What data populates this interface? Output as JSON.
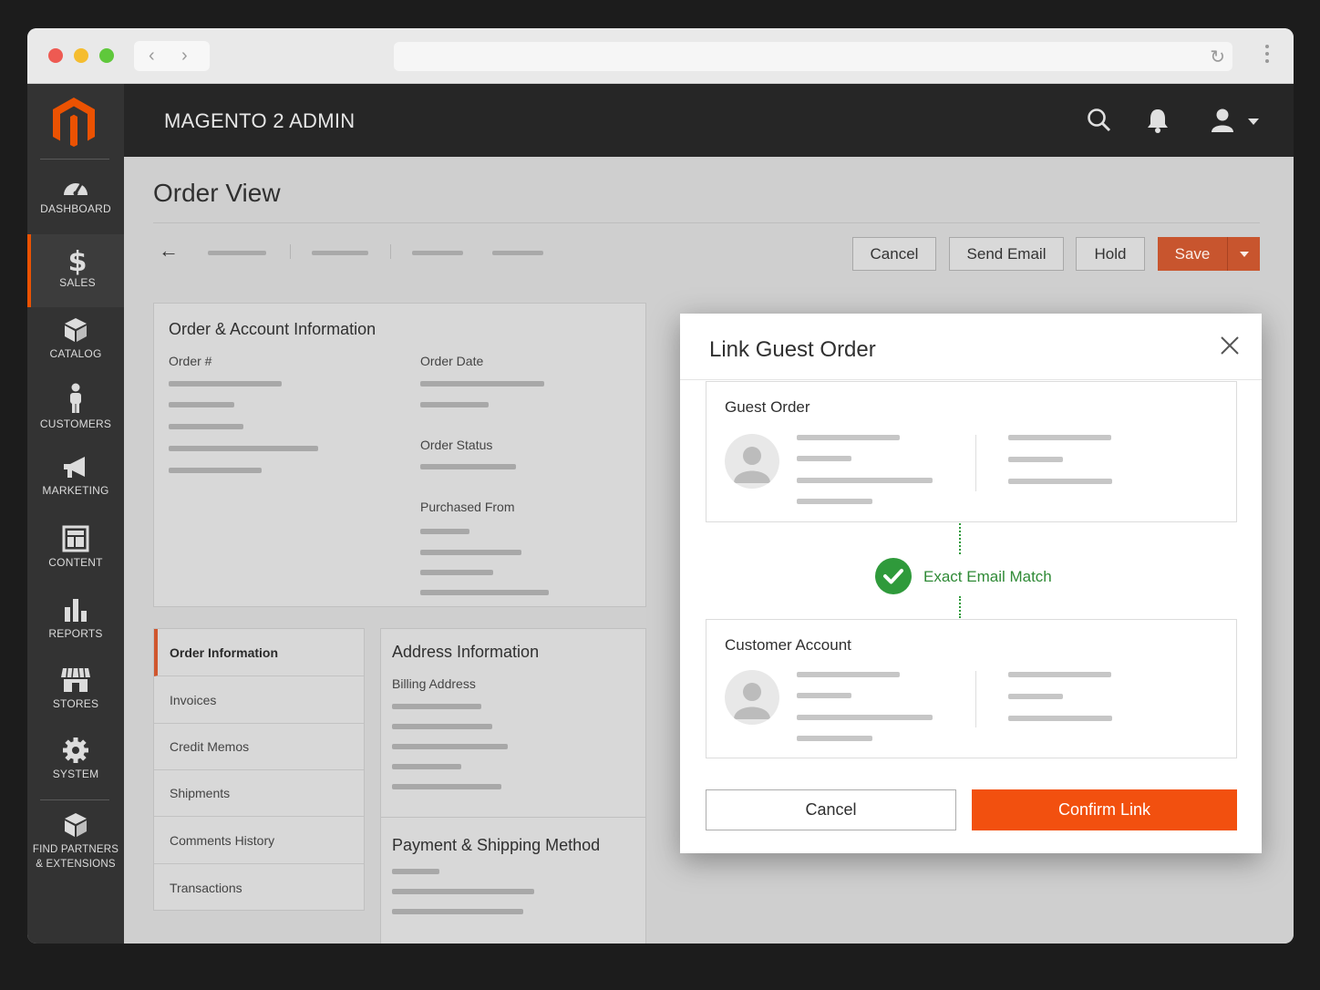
{
  "app": {
    "title": "MAGENTO 2 ADMIN"
  },
  "sidebar": {
    "items": [
      {
        "label": "DASHBOARD",
        "icon": "dashboard-icon"
      },
      {
        "label": "SALES",
        "icon": "dollar-icon",
        "active": true
      },
      {
        "label": "CATALOG",
        "icon": "box-icon"
      },
      {
        "label": "CUSTOMERS",
        "icon": "person-icon"
      },
      {
        "label": "MARKETING",
        "icon": "megaphone-icon"
      },
      {
        "label": "CONTENT",
        "icon": "layout-icon"
      },
      {
        "label": "REPORTS",
        "icon": "bar-chart-icon"
      },
      {
        "label": "STORES",
        "icon": "storefront-icon"
      },
      {
        "label": "SYSTEM",
        "icon": "gear-icon"
      }
    ],
    "partners": {
      "line1": "FIND PARTNERS",
      "line2": "& EXTENSIONS",
      "icon": "cube-icon"
    }
  },
  "header_icons": [
    "search-icon",
    "bell-icon",
    "user-icon",
    "caret-down-icon"
  ],
  "page": {
    "title": "Order View",
    "actions": {
      "cancel": "Cancel",
      "send_email": "Send Email",
      "hold": "Hold",
      "save": "Save"
    }
  },
  "order_account": {
    "title": "Order & Account Information",
    "order_number_label": "Order #",
    "order_date_label": "Order Date",
    "order_status_label": "Order Status",
    "purchased_from_label": "Purchased From"
  },
  "tabs": [
    "Order Information",
    "Invoices",
    "Credit Memos",
    "Shipments",
    "Comments History",
    "Transactions"
  ],
  "address": {
    "title": "Address Information",
    "billing_label": "Billing Address"
  },
  "payment": {
    "title": "Payment & Shipping Method"
  },
  "modal": {
    "title": "Link Guest Order",
    "guest_title": "Guest Order",
    "match_text": "Exact Email Match",
    "customer_title": "Customer Account",
    "cancel": "Cancel",
    "confirm": "Confirm Link"
  },
  "colors": {
    "brand": "#eb5202",
    "save": "#c8552e",
    "confirm": "#f2500f",
    "match": "#2f9a3b"
  }
}
